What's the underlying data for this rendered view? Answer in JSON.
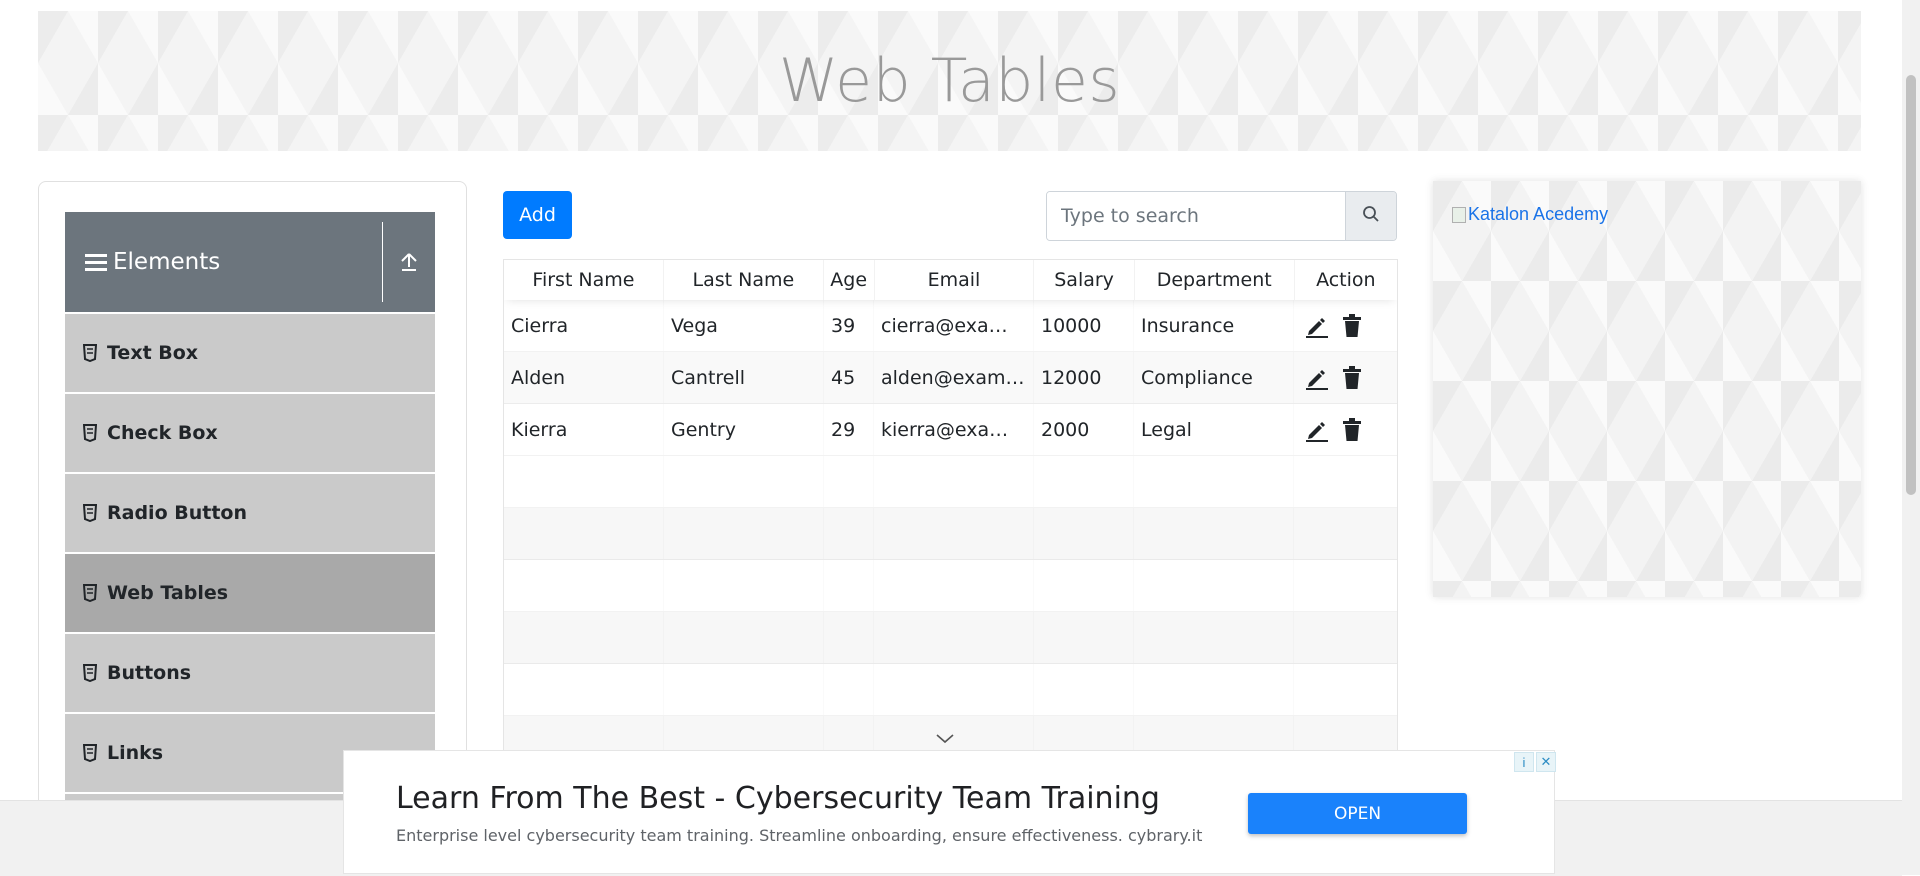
{
  "header": {
    "title": "Web Tables"
  },
  "sidebar": {
    "group_title": "Elements",
    "items": [
      {
        "label": "Text Box"
      },
      {
        "label": "Check Box"
      },
      {
        "label": "Radio Button"
      },
      {
        "label": "Web Tables",
        "active": true
      },
      {
        "label": "Buttons"
      },
      {
        "label": "Links"
      }
    ]
  },
  "toolbar": {
    "add_label": "Add",
    "search_placeholder": "Type to search"
  },
  "table": {
    "columns": [
      "First Name",
      "Last Name",
      "Age",
      "Email",
      "Salary",
      "Department",
      "Action"
    ],
    "rows": [
      {
        "first": "Cierra",
        "last": "Vega",
        "age": "39",
        "email": "cierra@example.com",
        "salary": "10000",
        "department": "Insurance"
      },
      {
        "first": "Alden",
        "last": "Cantrell",
        "age": "45",
        "email": "alden@example.com",
        "salary": "12000",
        "department": "Compliance"
      },
      {
        "first": "Kierra",
        "last": "Gentry",
        "age": "29",
        "email": "kierra@example.com",
        "salary": "2000",
        "department": "Legal"
      }
    ]
  },
  "ad_right": {
    "alt_text": "Katalon Acedemy"
  },
  "bottom_ad": {
    "headline": "Learn From The Best - Cybersecurity Team Training",
    "subline": "Enterprise level cybersecurity team training. Streamline onboarding, ensure effectiveness. cybrary.it",
    "open_label": "OPEN"
  },
  "colors": {
    "primary": "#007bff",
    "sidebar_header": "#6c757d",
    "menu_item": "#cacaca",
    "menu_active": "#a9a9a9"
  },
  "icons": [
    "hamburger-icon",
    "collapse-arrow-icon",
    "document-icon",
    "search-icon",
    "pencil-icon",
    "trash-icon",
    "chevron-down-icon",
    "info-icon",
    "close-icon"
  ]
}
